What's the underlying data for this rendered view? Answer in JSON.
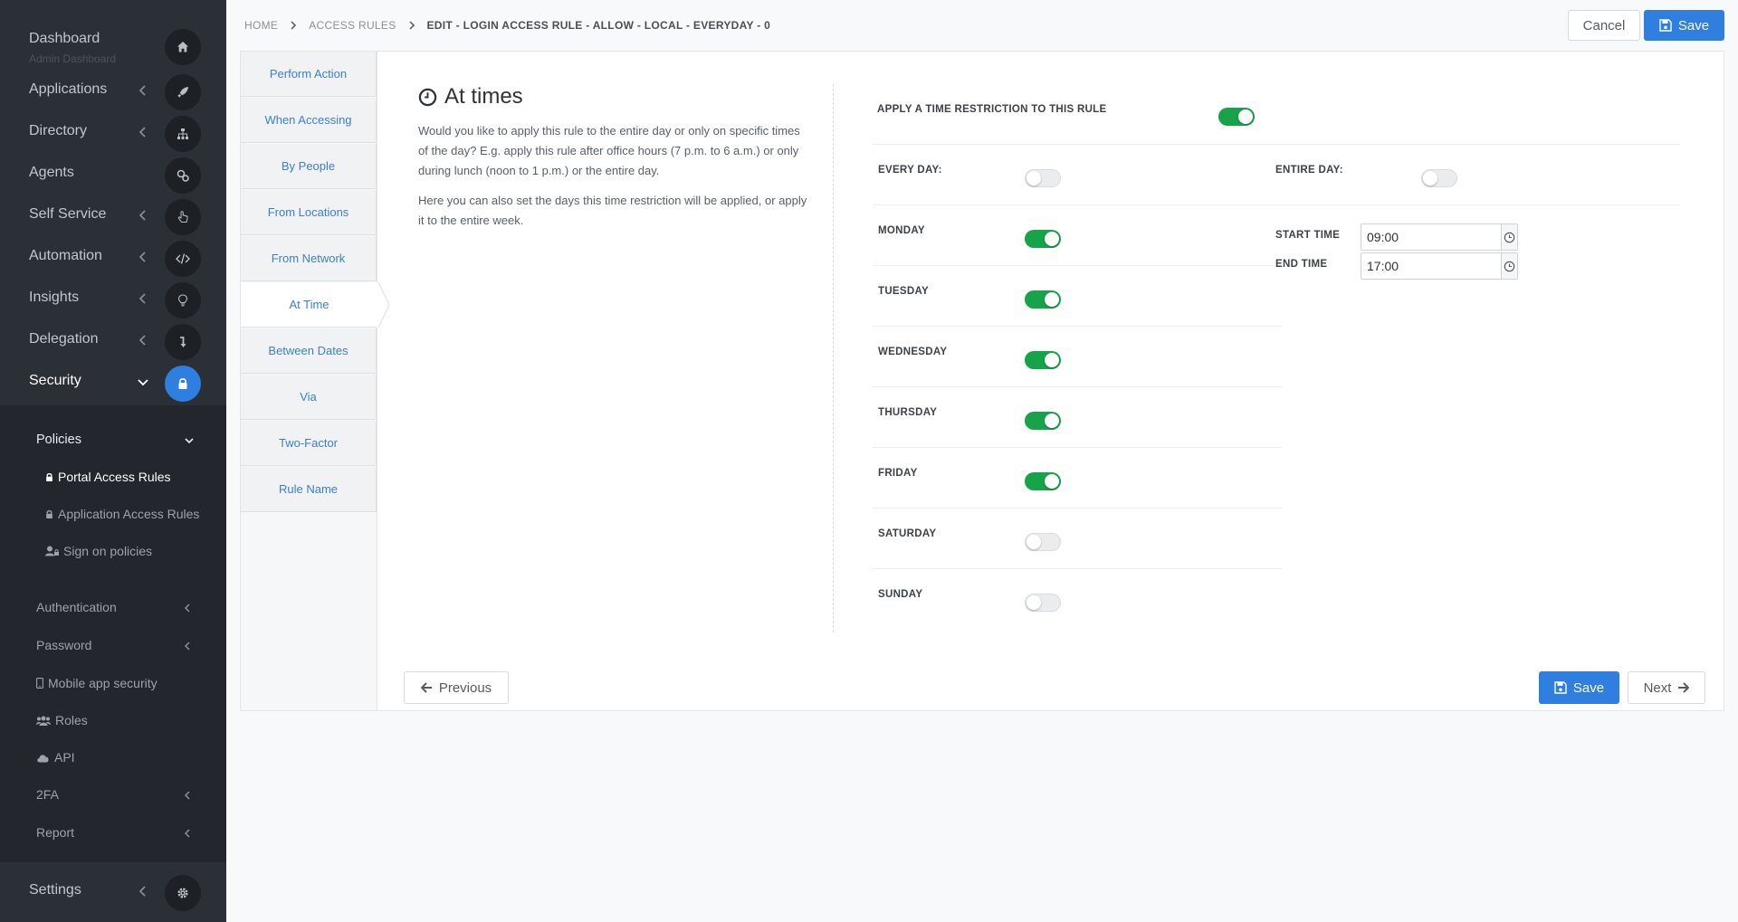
{
  "sidebar": {
    "dashboard": {
      "label": "Dashboard",
      "sub": "Admin Dashboard",
      "icon": "home-icon"
    },
    "applications": {
      "label": "Applications",
      "icon": "rocket-icon"
    },
    "directory": {
      "label": "Directory",
      "icon": "sitemap-icon"
    },
    "agents": {
      "label": "Agents",
      "icon": "cogs-icon"
    },
    "self_service": {
      "label": "Self Service",
      "icon": "hand-pointer-icon"
    },
    "automation": {
      "label": "Automation",
      "icon": "code-icon"
    },
    "insights": {
      "label": "Insights",
      "icon": "lightbulb-icon"
    },
    "delegation": {
      "label": "Delegation",
      "icon": "level-down-icon"
    },
    "security": {
      "label": "Security",
      "icon": "lock-icon"
    },
    "settings": {
      "label": "Settings",
      "icon": "gear-icon"
    },
    "security_menu": {
      "policies": "Policies",
      "portal_access_rules": "Portal Access Rules",
      "application_access_rules": "Application Access Rules",
      "sign_on_policies": "Sign on policies",
      "authentication": "Authentication",
      "password": "Password",
      "mobile_app_security": "Mobile app security",
      "roles": "Roles",
      "api": "API",
      "twofa": "2FA",
      "report": "Report"
    }
  },
  "breadcrumb": {
    "home": "HOME",
    "access_rules": "ACCESS RULES",
    "current": "EDIT - LOGIN ACCESS RULE - ALLOW - LOCAL - EVERYDAY - 0"
  },
  "header": {
    "cancel_label": "Cancel",
    "save_label": "Save"
  },
  "steps": [
    "Perform Action",
    "When Accessing",
    "By People",
    "From Locations",
    "From Network",
    "At Time",
    "Between Dates",
    "Via",
    "Two-Factor",
    "Rule Name"
  ],
  "active_step": "At Time",
  "section": {
    "title": "At times",
    "desc1": "Would you like to apply this rule to the entire day or only on specific times of the day? E.g. apply this rule after office hours (7 p.m. to 6 a.m.) or only during lunch (noon to 1 p.m.) or the entire day.",
    "desc2": "Here you can also set the days this time restriction will be applied, or apply it to the entire week."
  },
  "time_restriction": {
    "apply_label": "APPLY A TIME RESTRICTION TO THIS RULE",
    "apply_on": true,
    "every_day_label": "EVERY DAY:",
    "every_day_on": false,
    "entire_day_label": "ENTIRE DAY:",
    "entire_day_on": false,
    "days": [
      {
        "label": "MONDAY",
        "on": true
      },
      {
        "label": "TUESDAY",
        "on": true
      },
      {
        "label": "WEDNESDAY",
        "on": true
      },
      {
        "label": "THURSDAY",
        "on": true
      },
      {
        "label": "FRIDAY",
        "on": true
      },
      {
        "label": "SATURDAY",
        "on": false
      },
      {
        "label": "SUNDAY",
        "on": false
      }
    ],
    "start_time_label": "START TIME",
    "start_time": "09:00",
    "end_time_label": "END TIME",
    "end_time": "17:00"
  },
  "footer": {
    "previous_label": "Previous",
    "save_label": "Save",
    "next_label": "Next"
  },
  "colors": {
    "accent": "#2e7fe0",
    "toggle_on": "#16a34a",
    "sidebar_bg": "#2b2f36"
  }
}
